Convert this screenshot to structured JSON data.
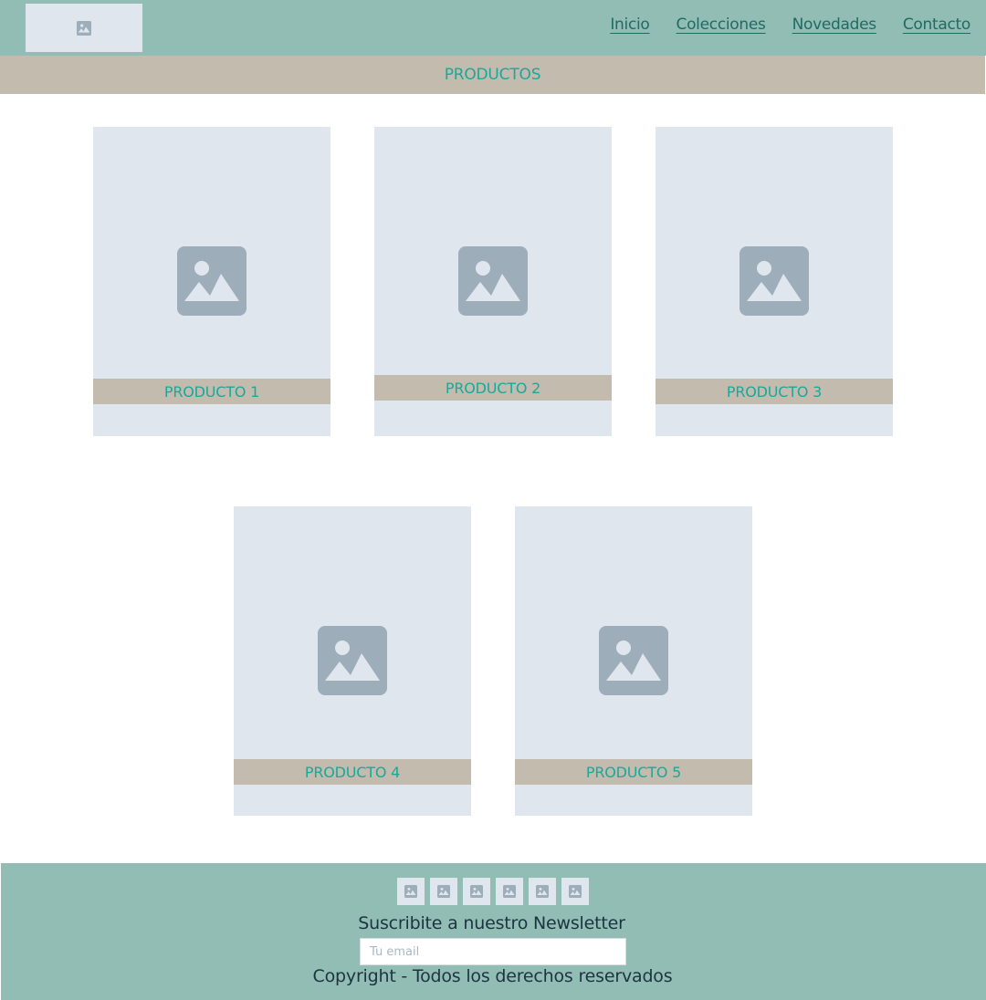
{
  "header": {
    "logo_icon": "image-placeholder-icon",
    "nav": [
      {
        "label": "Inicio"
      },
      {
        "label": "Colecciones"
      },
      {
        "label": "Novedades"
      },
      {
        "label": "Contacto"
      }
    ]
  },
  "banner": {
    "title": "PRODUCTOS"
  },
  "products": [
    {
      "label": "PRODUCTO 1",
      "icon": "image-placeholder-icon"
    },
    {
      "label": "PRODUCTO 2",
      "icon": "image-placeholder-icon"
    },
    {
      "label": "PRODUCTO 3",
      "icon": "image-placeholder-icon"
    },
    {
      "label": "PRODUCTO 4",
      "icon": "image-placeholder-icon"
    },
    {
      "label": "PRODUCTO 5",
      "icon": "image-placeholder-icon"
    }
  ],
  "footer": {
    "social_icons": [
      "image-placeholder-icon",
      "image-placeholder-icon",
      "image-placeholder-icon",
      "image-placeholder-icon",
      "image-placeholder-icon",
      "image-placeholder-icon"
    ],
    "newsletter_title": "Suscribite a nuestro Newsletter",
    "email_placeholder": "Tu email",
    "copyright": "Copyright - Todos los derechos reservados"
  },
  "colors": {
    "header_bg": "#92bdb4",
    "banner_bg": "#c3bbae",
    "accent_text": "#1aa89a",
    "nav_text": "#1f6b63",
    "placeholder_bg": "#dfe6ee",
    "placeholder_icon": "#9eadba"
  }
}
